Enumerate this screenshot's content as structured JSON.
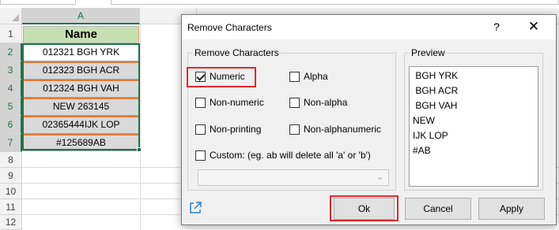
{
  "sheet": {
    "column_label": "A",
    "row_numbers": [
      "1",
      "2",
      "3",
      "4",
      "5",
      "6",
      "7",
      "8",
      "9",
      "10",
      "11",
      "12"
    ],
    "header_cell": "Name",
    "cells": [
      "012321 BGH YRK",
      "012323 BGH ACR",
      "012324 BGH VAH",
      "NEW 263145",
      "02365444IJK LOP",
      "#125689AB"
    ]
  },
  "dialog": {
    "title": "Remove Characters",
    "help_label": "?",
    "close_label": "✕",
    "group_label": "Remove Characters",
    "options": {
      "numeric": "Numeric",
      "alpha": "Alpha",
      "non_numeric": "Non-numeric",
      "non_alpha": "Non-alpha",
      "non_printing": "Non-printing",
      "non_alphanumeric": "Non-alphanumeric",
      "custom": "Custom:  (eg. ab will delete all 'a' or 'b')"
    },
    "checked": "numeric",
    "custom_value": "",
    "preview_label": "Preview",
    "preview_lines": [
      " BGH YRK",
      " BGH ACR",
      " BGH VAH",
      "NEW ",
      "IJK LOP",
      "#AB"
    ],
    "buttons": {
      "ok": "Ok",
      "cancel": "Cancel",
      "apply": "Apply"
    }
  },
  "colors": {
    "header_fill": "#c6e0b4",
    "data_fill": "#d9d9d9",
    "selection_green": "#217346",
    "highlight_red": "#e0282e"
  }
}
